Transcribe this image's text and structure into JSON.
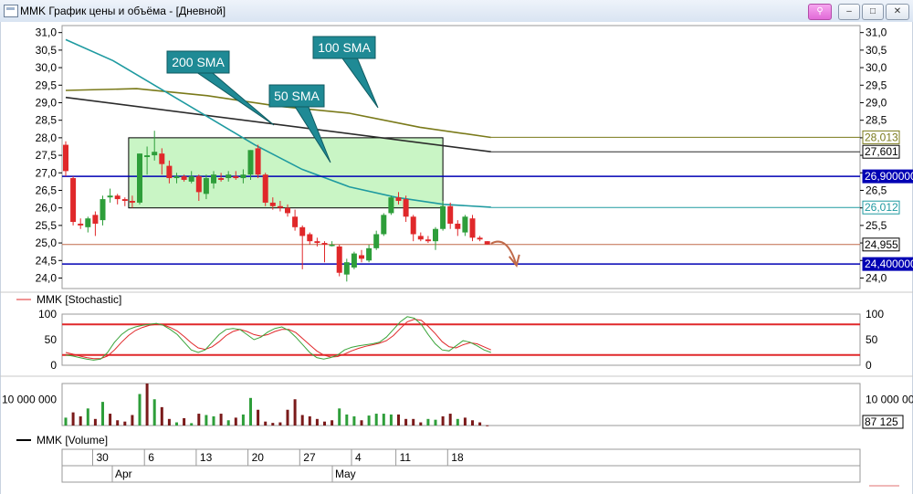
{
  "window": {
    "title": "MMK График цены и объёма - [Дневной]"
  },
  "window_buttons": {
    "pin": "⚲",
    "minimize": "–",
    "maximize": "□",
    "close": "✕"
  },
  "colors": {
    "up": "#2e9e3a",
    "down": "#e0282a",
    "sma50": "#1e9aa0",
    "sma100": "#7a7a1a",
    "sma200": "#2b2b2b",
    "hline": "#0000b4",
    "support": "#c06a4a",
    "stoch_level": "#e0282a",
    "callout_bg": "#1f8a95",
    "zone": "#c9f5c5",
    "vol_up": "#2e9e3a",
    "vol_down": "#7a1a1a"
  },
  "price_panel": {
    "y_ticks_left": [
      "31,0",
      "30,5",
      "30,0",
      "29,5",
      "29,0",
      "28,5",
      "28,0",
      "27,5",
      "27,0",
      "26,5",
      "26,0",
      "25,5",
      "25,0",
      "24,5",
      "24,0"
    ],
    "y_ticks_right": [
      "31,0",
      "30,5",
      "30,0",
      "29,5",
      "29,0",
      "28,5",
      "28,0",
      "27,5",
      "27,0",
      "26,5",
      "26,0",
      "25,5",
      "25,0",
      "24,5",
      "24,0"
    ],
    "right_labels": {
      "sma100": "28,013",
      "sma200": "27,601",
      "hline_top": "26,900000",
      "sma50": "26,012",
      "support": "24,955",
      "hline_bottom": "24,400000"
    },
    "annotations": {
      "sma200": "200 SMA",
      "sma100": "100 SMA",
      "sma50": "50 SMA"
    }
  },
  "stoch_panel": {
    "legend": "MMK [Stochastic]",
    "y_ticks_left": [
      "100",
      "50",
      "0"
    ],
    "y_ticks_right": [
      "100",
      "50",
      "0"
    ]
  },
  "volume_panel": {
    "y_tick_left": "10 000 000",
    "y_tick_right": "10 000 000",
    "last_value": "87 125",
    "legend": "MMK [Volume]"
  },
  "time_axis": {
    "days": [
      "30",
      "6",
      "13",
      "20",
      "27",
      "4",
      "11",
      "18"
    ],
    "months": [
      "Apr",
      "May"
    ]
  },
  "chart_data": {
    "type": "candlestick",
    "ylim": [
      23.7,
      31.2
    ],
    "candles": [
      {
        "o": 27.8,
        "h": 27.9,
        "l": 26.9,
        "c": 27.05
      },
      {
        "o": 26.85,
        "h": 26.9,
        "l": 25.5,
        "c": 25.6
      },
      {
        "o": 25.55,
        "h": 25.7,
        "l": 25.4,
        "c": 25.5
      },
      {
        "o": 25.45,
        "h": 25.75,
        "l": 25.3,
        "c": 25.7
      },
      {
        "o": 25.8,
        "h": 25.9,
        "l": 25.2,
        "c": 25.55
      },
      {
        "o": 25.65,
        "h": 26.35,
        "l": 25.5,
        "c": 26.25
      },
      {
        "o": 26.3,
        "h": 26.55,
        "l": 26.15,
        "c": 26.35
      },
      {
        "o": 26.35,
        "h": 26.4,
        "l": 26.1,
        "c": 26.25
      },
      {
        "o": 26.25,
        "h": 26.3,
        "l": 26.05,
        "c": 26.2
      },
      {
        "o": 26.2,
        "h": 26.35,
        "l": 26.0,
        "c": 26.15
      },
      {
        "o": 26.15,
        "h": 27.55,
        "l": 26.1,
        "c": 27.55
      },
      {
        "o": 27.45,
        "h": 27.75,
        "l": 26.95,
        "c": 27.5
      },
      {
        "o": 27.5,
        "h": 28.2,
        "l": 27.35,
        "c": 27.6
      },
      {
        "o": 27.55,
        "h": 27.7,
        "l": 26.95,
        "c": 27.25
      },
      {
        "o": 27.2,
        "h": 27.35,
        "l": 26.7,
        "c": 26.85
      },
      {
        "o": 26.85,
        "h": 27.0,
        "l": 26.7,
        "c": 26.9
      },
      {
        "o": 26.9,
        "h": 26.95,
        "l": 26.75,
        "c": 26.8
      },
      {
        "o": 26.75,
        "h": 27.05,
        "l": 26.7,
        "c": 26.9
      },
      {
        "o": 26.9,
        "h": 26.95,
        "l": 26.2,
        "c": 26.45
      },
      {
        "o": 26.4,
        "h": 26.95,
        "l": 26.25,
        "c": 26.85
      },
      {
        "o": 26.7,
        "h": 27.05,
        "l": 26.55,
        "c": 26.95
      },
      {
        "o": 26.85,
        "h": 27.0,
        "l": 26.75,
        "c": 26.8
      },
      {
        "o": 26.85,
        "h": 27.05,
        "l": 26.75,
        "c": 26.95
      },
      {
        "o": 26.9,
        "h": 27.05,
        "l": 26.8,
        "c": 26.85
      },
      {
        "o": 26.85,
        "h": 27.1,
        "l": 26.7,
        "c": 26.95
      },
      {
        "o": 26.95,
        "h": 27.65,
        "l": 26.8,
        "c": 27.65
      },
      {
        "o": 27.7,
        "h": 27.8,
        "l": 26.85,
        "c": 26.95
      },
      {
        "o": 26.95,
        "h": 27.0,
        "l": 26.05,
        "c": 26.15
      },
      {
        "o": 26.15,
        "h": 26.3,
        "l": 25.95,
        "c": 26.05
      },
      {
        "o": 26.05,
        "h": 26.2,
        "l": 25.9,
        "c": 26.0
      },
      {
        "o": 26.0,
        "h": 26.1,
        "l": 25.75,
        "c": 25.85
      },
      {
        "o": 25.75,
        "h": 25.95,
        "l": 25.35,
        "c": 25.45
      },
      {
        "o": 25.45,
        "h": 25.5,
        "l": 24.25,
        "c": 25.2
      },
      {
        "o": 25.25,
        "h": 25.3,
        "l": 24.95,
        "c": 25.05
      },
      {
        "o": 25.05,
        "h": 25.15,
        "l": 24.9,
        "c": 25.0
      },
      {
        "o": 25.0,
        "h": 25.05,
        "l": 24.45,
        "c": 24.95
      },
      {
        "o": 24.95,
        "h": 25.05,
        "l": 24.9,
        "c": 24.95
      },
      {
        "o": 24.9,
        "h": 24.95,
        "l": 24.05,
        "c": 24.15
      },
      {
        "o": 24.1,
        "h": 24.55,
        "l": 23.9,
        "c": 24.45
      },
      {
        "o": 24.3,
        "h": 24.75,
        "l": 24.25,
        "c": 24.7
      },
      {
        "o": 24.65,
        "h": 24.8,
        "l": 24.45,
        "c": 24.55
      },
      {
        "o": 24.5,
        "h": 24.95,
        "l": 24.45,
        "c": 24.85
      },
      {
        "o": 24.85,
        "h": 25.35,
        "l": 24.8,
        "c": 25.25
      },
      {
        "o": 25.25,
        "h": 25.85,
        "l": 25.2,
        "c": 25.8
      },
      {
        "o": 25.85,
        "h": 26.35,
        "l": 25.8,
        "c": 26.3
      },
      {
        "o": 26.3,
        "h": 26.45,
        "l": 26.1,
        "c": 26.2
      },
      {
        "o": 26.25,
        "h": 26.35,
        "l": 25.6,
        "c": 25.75
      },
      {
        "o": 25.75,
        "h": 25.8,
        "l": 25.05,
        "c": 25.25
      },
      {
        "o": 25.2,
        "h": 25.3,
        "l": 25.05,
        "c": 25.1
      },
      {
        "o": 25.1,
        "h": 25.2,
        "l": 25.0,
        "c": 25.05
      },
      {
        "o": 25.05,
        "h": 25.45,
        "l": 24.8,
        "c": 25.4
      },
      {
        "o": 25.4,
        "h": 26.2,
        "l": 25.35,
        "c": 26.05
      },
      {
        "o": 26.05,
        "h": 26.15,
        "l": 25.4,
        "c": 25.55
      },
      {
        "o": 25.55,
        "h": 25.65,
        "l": 25.2,
        "c": 25.4
      },
      {
        "o": 25.3,
        "h": 25.8,
        "l": 25.2,
        "c": 25.75
      },
      {
        "o": 25.7,
        "h": 25.8,
        "l": 25.05,
        "c": 25.15
      },
      {
        "o": 25.15,
        "h": 25.2,
        "l": 25.05,
        "c": 25.1
      },
      {
        "o": 25.05,
        "h": 25.05,
        "l": 24.95,
        "c": 24.96
      }
    ],
    "series": [
      {
        "name": "200 SMA",
        "x0": 0,
        "x1": 65,
        "values": [
          29.15,
          27.6
        ]
      },
      {
        "name": "100 SMA",
        "x0": 0,
        "x1": 65,
        "values": [
          29.35,
          29.4,
          29.2,
          28.9,
          28.7,
          28.3,
          28.01
        ]
      },
      {
        "name": "50 SMA",
        "x0": 0,
        "x1": 65,
        "values": [
          30.8,
          30.2,
          29.4,
          28.6,
          27.8,
          27.1,
          26.6,
          26.3,
          26.1,
          26.02
        ]
      }
    ],
    "hlines": [
      26.9,
      24.4,
      24.955,
      28.013,
      27.601,
      26.012
    ],
    "zone": {
      "from_index": 9,
      "to_index": 51,
      "from_price": 26.0,
      "to_price": 28.0
    },
    "stochastic": {
      "ylim": [
        0,
        100
      ],
      "levels": [
        80,
        20
      ],
      "k": [
        20,
        18,
        15,
        12,
        10,
        12,
        25,
        45,
        60,
        70,
        75,
        78,
        80,
        82,
        78,
        70,
        60,
        45,
        30,
        25,
        30,
        45,
        60,
        70,
        72,
        70,
        60,
        50,
        55,
        65,
        72,
        75,
        68,
        55,
        40,
        25,
        15,
        12,
        15,
        20,
        30,
        35,
        38,
        40,
        42,
        45,
        55,
        70,
        85,
        95,
        92,
        80,
        60,
        42,
        30,
        28,
        38,
        48,
        45,
        38,
        30,
        25
      ],
      "d": [
        25,
        22,
        18,
        15,
        13,
        13,
        18,
        30,
        45,
        58,
        68,
        74,
        78,
        80,
        79,
        74,
        67,
        56,
        44,
        34,
        31,
        36,
        46,
        58,
        66,
        70,
        66,
        60,
        57,
        60,
        66,
        70,
        70,
        64,
        52,
        40,
        28,
        20,
        16,
        17,
        22,
        28,
        33,
        37,
        40,
        43,
        48,
        58,
        72,
        85,
        90,
        88,
        76,
        62,
        46,
        36,
        34,
        40,
        44,
        42,
        36,
        30
      ]
    },
    "volume": {
      "ylim": [
        0,
        16000000
      ],
      "values": [
        3000000,
        5000000,
        3500000,
        6500000,
        2500000,
        9000000,
        4500000,
        2000000,
        1500000,
        4000000,
        12000000,
        16000000,
        10000000,
        7000000,
        2500000,
        1200000,
        2800000,
        900000,
        4500000,
        4000000,
        3500000,
        4500000,
        2000000,
        3000000,
        4200000,
        10500000,
        6000000,
        1500000,
        1000000,
        1200000,
        6000000,
        10000000,
        4000000,
        3500000,
        2500000,
        1500000,
        2000000,
        6500000,
        4200000,
        3500000,
        2000000,
        3800000,
        4500000,
        4500000,
        4200000,
        4200000,
        2500000,
        2500000,
        1200000,
        2500000,
        2200000,
        3500000,
        4500000,
        2500000,
        3000000,
        2000000,
        1200000,
        87125
      ],
      "colors": [
        "u",
        "d",
        "d",
        "u",
        "d",
        "u",
        "d",
        "d",
        "d",
        "d",
        "u",
        "d",
        "u",
        "d",
        "d",
        "u",
        "d",
        "u",
        "d",
        "u",
        "u",
        "d",
        "u",
        "d",
        "u",
        "u",
        "d",
        "d",
        "d",
        "d",
        "d",
        "d",
        "d",
        "d",
        "d",
        "d",
        "d",
        "u",
        "u",
        "u",
        "d",
        "u",
        "u",
        "u",
        "u",
        "d",
        "d",
        "d",
        "d",
        "u",
        "u",
        "d",
        "d",
        "u",
        "d",
        "d",
        "d",
        "d"
      ]
    }
  }
}
